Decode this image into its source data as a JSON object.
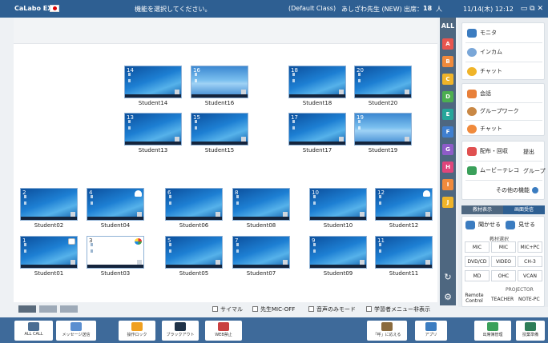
{
  "header": {
    "app_title": "CaLabo EX",
    "status_message": "機能を選択してください。",
    "class_name": "(Default Class)",
    "teacher_name": "あしざわ先生 (NEW)",
    "attendance_label": "出席：",
    "attendance_count": "18",
    "attendance_unit": "人",
    "datetime": "11/14(木) 12:12",
    "window_controls": "▭ ⧉ ✕"
  },
  "students": [
    {
      "num": "14",
      "name": "Student14",
      "screen": "wallpaper"
    },
    {
      "num": "16",
      "name": "Student16",
      "screen": "light"
    },
    {
      "num": "18",
      "name": "Student18",
      "screen": "wallpaper"
    },
    {
      "num": "20",
      "name": "Student20",
      "screen": "wallpaper"
    },
    {
      "num": "13",
      "name": "Student13",
      "screen": "wallpaper"
    },
    {
      "num": "15",
      "name": "Student15",
      "screen": "wallpaper"
    },
    {
      "num": "17",
      "name": "Student17",
      "screen": "wallpaper"
    },
    {
      "num": "19",
      "name": "Student19",
      "screen": "light"
    },
    {
      "num": "2",
      "name": "Student02",
      "screen": "wallpaper"
    },
    {
      "num": "4",
      "name": "Student04",
      "screen": "wallpaper",
      "badge": "cloud-icon"
    },
    {
      "num": "6",
      "name": "Student06",
      "screen": "wallpaper"
    },
    {
      "num": "8",
      "name": "Student08",
      "screen": "wallpaper"
    },
    {
      "num": "10",
      "name": "Student10",
      "screen": "wallpaper"
    },
    {
      "num": "12",
      "name": "Student12",
      "screen": "wallpaper",
      "badge": "cloud-icon"
    },
    {
      "num": "1",
      "name": "Student01",
      "screen": "wallpaper",
      "badge": "white-square-icon"
    },
    {
      "num": "3",
      "name": "Student03",
      "screen": "blank",
      "badge": "color-ball-icon"
    },
    {
      "num": "5",
      "name": "Student05",
      "screen": "wallpaper"
    },
    {
      "num": "7",
      "name": "Student07",
      "screen": "wallpaper"
    },
    {
      "num": "9",
      "name": "Student09",
      "screen": "wallpaper"
    },
    {
      "num": "11",
      "name": "Student11",
      "screen": "wallpaper"
    }
  ],
  "groups": {
    "all_label": "ALL",
    "tabs": [
      {
        "label": "A",
        "color": "#e8554e"
      },
      {
        "label": "B",
        "color": "#f08a3c"
      },
      {
        "label": "C",
        "color": "#f0b429"
      },
      {
        "label": "D",
        "color": "#4caf50"
      },
      {
        "label": "E",
        "color": "#26a69a"
      },
      {
        "label": "F",
        "color": "#3f7fd0"
      },
      {
        "label": "G",
        "color": "#8e5cc8"
      },
      {
        "label": "H",
        "color": "#e0457b"
      },
      {
        "label": "I",
        "color": "#f08a3c"
      },
      {
        "label": "J",
        "color": "#f0b429"
      }
    ],
    "refresh_icon": "refresh-icon",
    "settings_icon": "gear-icon"
  },
  "panel": {
    "monitor": "モニタ",
    "intercom": "インカム",
    "chat1": "チャット",
    "meeting": "会話",
    "group_work": "グループワーク",
    "chat2": "チャット",
    "distribute": "配布・回収",
    "submit": "提出",
    "movie": "ムービーテレコ",
    "group": "グループ",
    "other": "その他の機能",
    "tab_material": "教材表示",
    "tab_screen": "画面受信",
    "listen": "聞かせる",
    "show": "見せる",
    "material_select": "教材選択",
    "sources": [
      "MIC",
      "MIC",
      "MIC+PC",
      "DVD/CD",
      "VIDEO",
      "CH-3",
      "MD",
      "OHC",
      "VCAN"
    ],
    "projector": "PROJECTOR",
    "remote_control": "Remote Control",
    "teacher": "TEACHER",
    "note_pc": "NOTE-PC"
  },
  "view_options": {
    "layout_tabs": [
      "grid",
      "list",
      "detail"
    ],
    "options": [
      "サイマル",
      "先生MIC-OFF",
      "音声のみモード",
      "学習者メニュー非表示"
    ]
  },
  "bottom_bar": {
    "buttons": [
      {
        "label": "ALL CALL",
        "icon": "microphone-icon",
        "color": "#4a6d93"
      },
      {
        "label": "メッセージ送信",
        "icon": "message-icon",
        "color": "#5b8fd0"
      },
      {
        "label": "操作ロック",
        "icon": "lock-icon",
        "color": "#f0a020"
      },
      {
        "label": "ブラックアウト",
        "icon": "monitor-off-icon",
        "color": "#1f3247"
      },
      {
        "label": "WEB禁止",
        "icon": "web-block-icon",
        "color": "#c94040"
      },
      {
        "label": "「呼」に応える",
        "icon": "raised-hand-icon",
        "color": "#8a6b3e"
      },
      {
        "label": "アプリ",
        "icon": "app-icon",
        "color": "#3b7cc0"
      },
      {
        "label": "出席簿管理",
        "icon": "attendance-icon",
        "color": "#3aa05a"
      },
      {
        "label": "授業準備",
        "icon": "lesson-prep-icon",
        "color": "#2e7d57"
      }
    ]
  }
}
